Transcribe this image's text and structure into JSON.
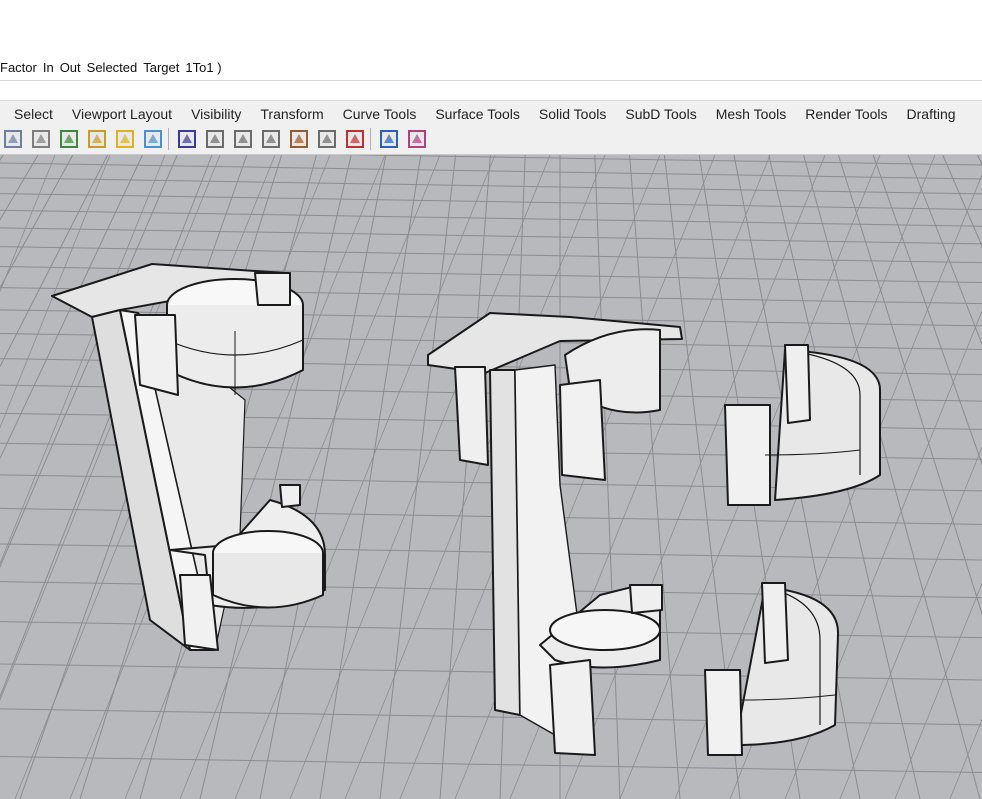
{
  "command_line": {
    "options": [
      "Factor",
      "In",
      "Out",
      "Selected",
      "Target",
      "1To1 )"
    ]
  },
  "menu_tabs": [
    {
      "label": "Select"
    },
    {
      "label": "Viewport Layout"
    },
    {
      "label": "Visibility"
    },
    {
      "label": "Transform"
    },
    {
      "label": "Curve Tools"
    },
    {
      "label": "Surface Tools"
    },
    {
      "label": "Solid Tools"
    },
    {
      "label": "SubD Tools"
    },
    {
      "label": "Mesh Tools"
    },
    {
      "label": "Render Tools"
    },
    {
      "label": "Drafting"
    }
  ],
  "toolbar": {
    "icons": [
      "undo-view-icon",
      "select-cursor-icon",
      "grid-icon",
      "save-icon",
      "open-folder-icon",
      "plane-grid-icon",
      "eye-view-icon",
      "move-down-icon",
      "move-up-icon",
      "move-left-icon",
      "rotate-icon",
      "move-arrows-icon",
      "arrows-right-icon",
      "render-box-icon",
      "render-material-icon"
    ]
  },
  "viewport": {
    "background": "#b7b9bc",
    "grid_color": "#8a8c8f",
    "objects": [
      "clamp-assembly-left",
      "clamp-assembly-middle",
      "half-clip-upper-right",
      "half-clip-lower-right"
    ]
  }
}
